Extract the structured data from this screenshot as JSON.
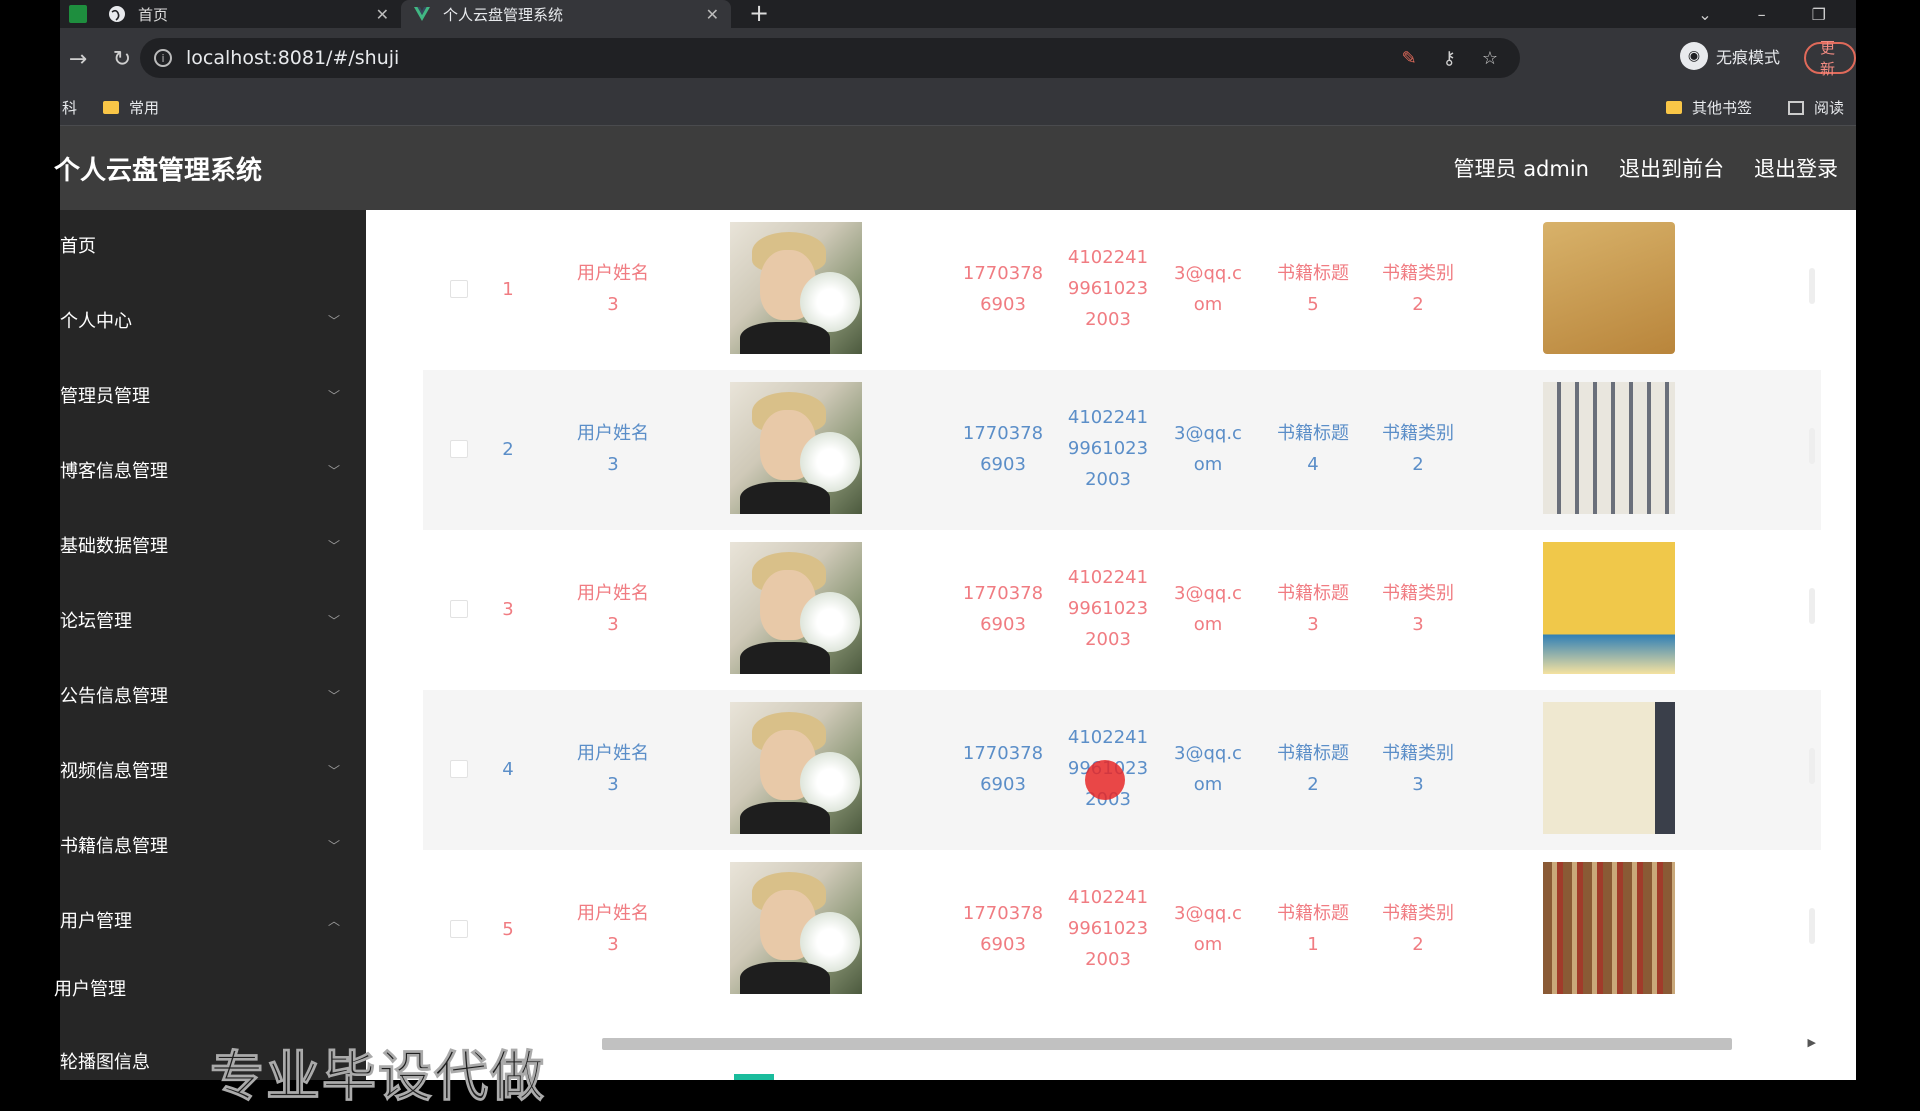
{
  "browser": {
    "tabs": [
      {
        "label": "首页"
      },
      {
        "label": "个人云盘管理系统"
      }
    ],
    "url": "localhost:8081/#/shuji",
    "incognito_label": "无痕模式",
    "update_label": "更新",
    "bookmarks": {
      "left_partial": "科",
      "common": "常用",
      "other": "其他书签",
      "reading": "阅读"
    }
  },
  "header": {
    "title": "个人云盘管理系统",
    "admin": "管理员 admin",
    "to_front": "退出到前台",
    "logout": "退出登录"
  },
  "sidebar": {
    "items": [
      {
        "label": "首页",
        "expandable": false
      },
      {
        "label": "个人中心",
        "expandable": true
      },
      {
        "label": "管理员管理",
        "expandable": true
      },
      {
        "label": "博客信息管理",
        "expandable": true
      },
      {
        "label": "基础数据管理",
        "expandable": true
      },
      {
        "label": "论坛管理",
        "expandable": true
      },
      {
        "label": "公告信息管理",
        "expandable": true
      },
      {
        "label": "视频信息管理",
        "expandable": true
      },
      {
        "label": "书籍信息管理",
        "expandable": true
      },
      {
        "label": "用户管理",
        "expandable": true,
        "open": true
      },
      {
        "label": "用户管理",
        "expandable": false
      },
      {
        "label": "轮播图信息",
        "expandable": false
      }
    ]
  },
  "table": {
    "rows": [
      {
        "index": "1",
        "name": [
          "用户姓名",
          "3"
        ],
        "phone": [
          "1770378",
          "6903"
        ],
        "idcard": [
          "4102241",
          "9961023",
          "2003"
        ],
        "email": [
          "3@qq.c",
          "om"
        ],
        "book_title": [
          "书籍标题",
          "5"
        ],
        "book_type": [
          "书籍类别",
          "2"
        ],
        "color": "#f07c82"
      },
      {
        "index": "2",
        "name": [
          "用户姓名",
          "3"
        ],
        "phone": [
          "1770378",
          "6903"
        ],
        "idcard": [
          "4102241",
          "9961023",
          "2003"
        ],
        "email": [
          "3@qq.c",
          "om"
        ],
        "book_title": [
          "书籍标题",
          "4"
        ],
        "book_type": [
          "书籍类别",
          "2"
        ],
        "color": "#5b8ec8"
      },
      {
        "index": "3",
        "name": [
          "用户姓名",
          "3"
        ],
        "phone": [
          "1770378",
          "6903"
        ],
        "idcard": [
          "4102241",
          "9961023",
          "2003"
        ],
        "email": [
          "3@qq.c",
          "om"
        ],
        "book_title": [
          "书籍标题",
          "3"
        ],
        "book_type": [
          "书籍类别",
          "3"
        ],
        "color": "#f07c82"
      },
      {
        "index": "4",
        "name": [
          "用户姓名",
          "3"
        ],
        "phone": [
          "1770378",
          "6903"
        ],
        "idcard": [
          "4102241",
          "9961023",
          "2003"
        ],
        "email": [
          "3@qq.c",
          "om"
        ],
        "book_title": [
          "书籍标题",
          "2"
        ],
        "book_type": [
          "书籍类别",
          "3"
        ],
        "color": "#5b8ec8"
      },
      {
        "index": "5",
        "name": [
          "用户姓名",
          "3"
        ],
        "phone": [
          "1770378",
          "6903"
        ],
        "idcard": [
          "4102241",
          "9961023",
          "2003"
        ],
        "email": [
          "3@qq.c",
          "om"
        ],
        "book_title": [
          "书籍标题",
          "1"
        ],
        "book_type": [
          "书籍类别",
          "2"
        ],
        "color": "#f07c82"
      }
    ]
  },
  "overlay": {
    "watermark": "专业毕设代做"
  },
  "icons": [
    "sheet-icon",
    "globe-icon",
    "vue-icon",
    "close-icon",
    "plus-icon",
    "back-icon",
    "reload-icon",
    "info-icon",
    "key-icon",
    "star-icon",
    "incognito-icon",
    "folder-icon",
    "reading-list-icon",
    "chevron-down-icon",
    "chevron-up-icon"
  ]
}
